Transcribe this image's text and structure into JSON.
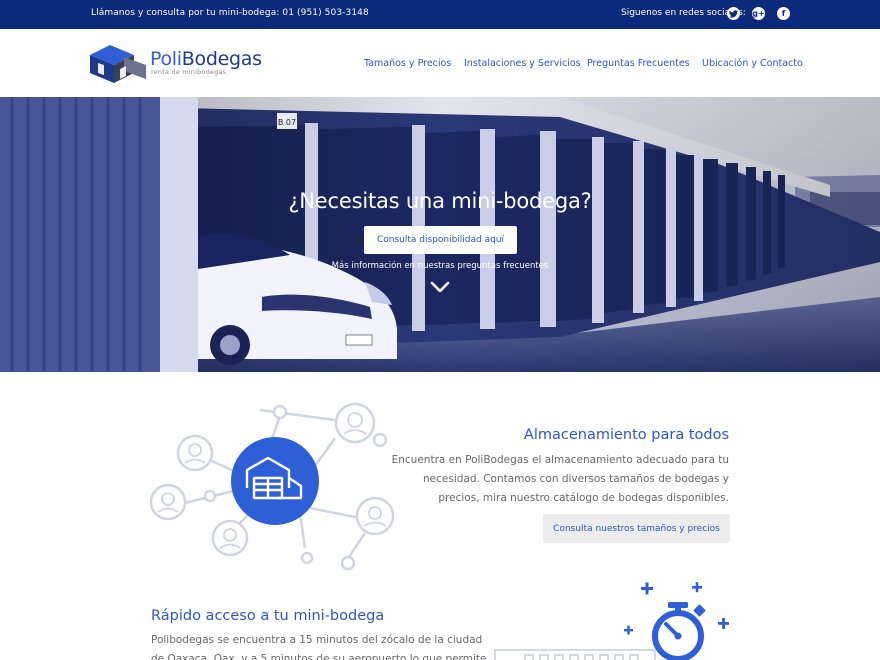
{
  "topbar": {
    "phone_text": "Llámanos y consulta por tu mini-bodega: 01 (951) 503-3148",
    "social_label": "Siguenos en redes sociales:",
    "social_icons": [
      "twitter-icon",
      "google-plus-icon",
      "facebook-icon"
    ]
  },
  "header": {
    "logo_name_a": "Poli",
    "logo_name_b": "Bodegas",
    "logo_tagline": "renta de minibodegas",
    "nav": [
      "Tamaños y Precios",
      "Instalaciones y Servicios",
      "Preguntas Frecuentes",
      "Ubicación y Contacto"
    ]
  },
  "hero": {
    "title": "¿Necesitas una mini-bodega?",
    "button_label": "Consulta disponibilidad aquí",
    "faq_link": "Más información en nuestras preguntas frecuentes",
    "door_number": "B 07"
  },
  "section1": {
    "title": "Almacenamiento para  todos",
    "text": "Encuentra en PoliBodegas el almacenamiento adecuado para tu necesidad. Contamos con diversos tamaños de bodegas  y precios, mira nuestro catálogo de bodegas disponibles.",
    "button_label": "Consulta nuestros tamaños y precios"
  },
  "section2": {
    "title": "Rápido acceso a tu mini-bodega",
    "text": "Polibodegas se encuentra a 15 minutos del zócalo de la ciudad de Oaxaca, Oax. y a 5 minutos de su aeropuerto lo que permite"
  },
  "colors": {
    "topbar": "#0c2a7c",
    "accent": "#2b56c9",
    "circle": "#2f5fd6",
    "illustration_line": "#c9cfda"
  }
}
